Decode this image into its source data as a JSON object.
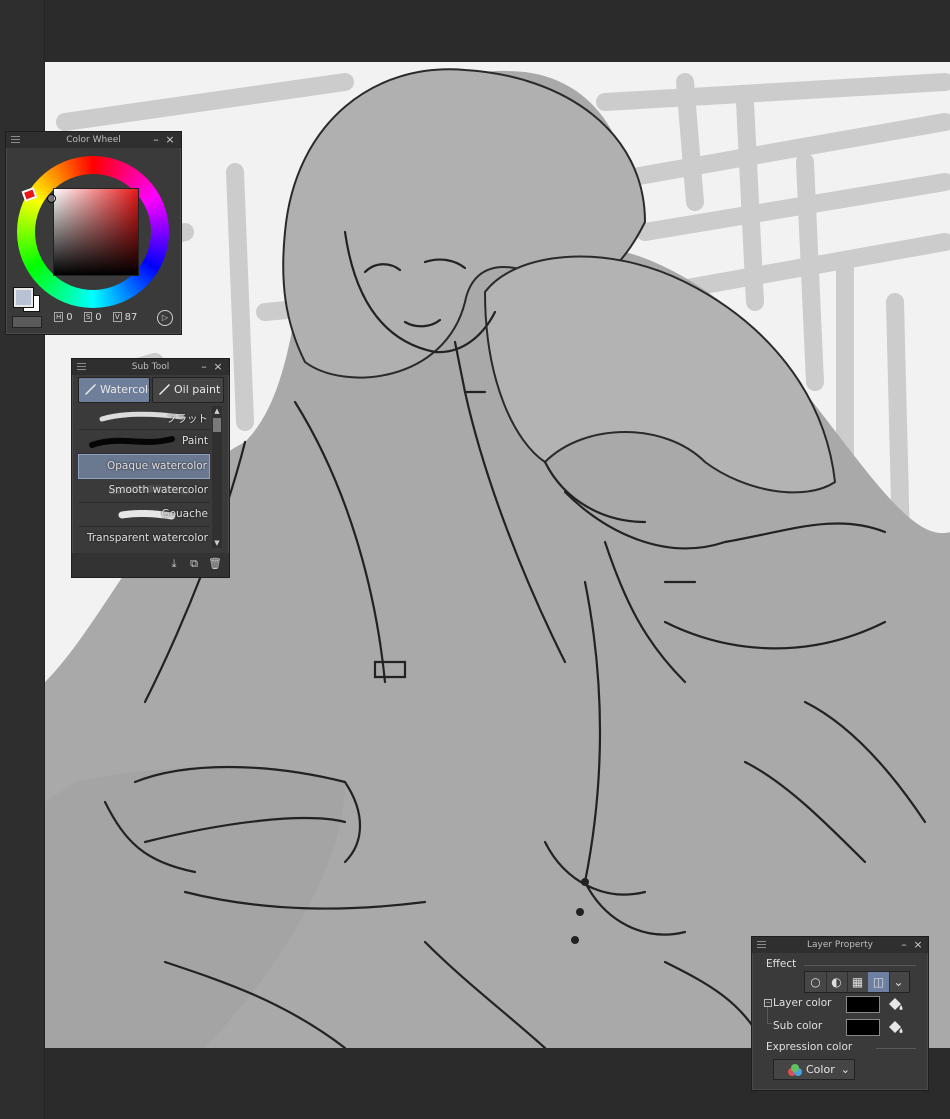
{
  "color_wheel": {
    "title": "Color Wheel",
    "hsv_readout": {
      "h_key": "H",
      "h": "0",
      "s_key": "S",
      "s": "0",
      "v_key": "V",
      "v": "87"
    },
    "main_color": "#b9c1d4",
    "sub_color": "#ffffff"
  },
  "sub_tool": {
    "title": "Sub Tool",
    "tabs": [
      {
        "label": "Watercolor"
      },
      {
        "label": "Oil paint"
      }
    ],
    "items": [
      {
        "label": "フラット",
        "stroke": "light"
      },
      {
        "label": "Paint",
        "stroke": "dark"
      },
      {
        "label": "Opaque watercolor",
        "stroke": "none"
      },
      {
        "label": "Smooth watercolor",
        "stroke": "soft"
      },
      {
        "label": "Gouache",
        "stroke": "textured"
      },
      {
        "label": "Transparent watercolor",
        "stroke": "none"
      }
    ],
    "selected_index": 2
  },
  "layer_property": {
    "title": "Layer Property",
    "effect_label": "Effect",
    "layer_color_label": "Layer color",
    "sub_color_label": "Sub color",
    "layer_color_value": "#000000",
    "sub_color_value": "#000000",
    "expression_color_label": "Expression color",
    "expression_color_value": "Color"
  }
}
